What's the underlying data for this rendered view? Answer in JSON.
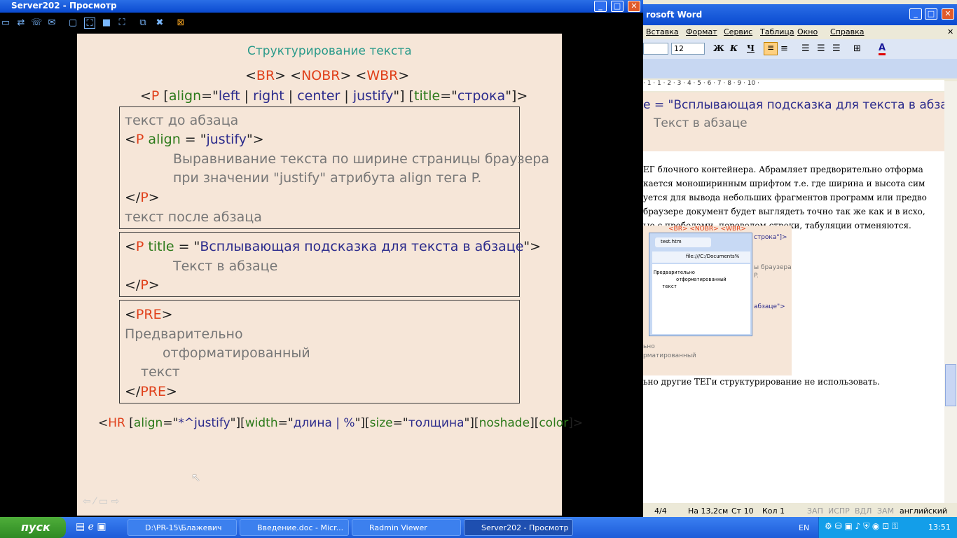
{
  "radmin": {
    "title": "Server202 - Просмотр"
  },
  "slide": {
    "heading": "Структурирование текста",
    "line1": [
      "<",
      "BR",
      "> <",
      "NOBR",
      "> <",
      "WBR",
      ">"
    ],
    "line2": [
      "<",
      "P",
      " [",
      "align",
      "=\"",
      "left",
      " | ",
      "right",
      " | ",
      "center",
      " | ",
      "justify",
      "\"] [",
      "title",
      "=\"",
      "строка",
      "\"]>"
    ],
    "box1": {
      "l1": "текст до абзаца",
      "l2": [
        "<",
        "P",
        " align",
        " = \"",
        "justify",
        "\">"
      ],
      "l3": "Выравнивание текста по ширине страницы браузера",
      "l4": "при значении \"justify\" атрибута align тега P.",
      "l5": [
        "</",
        "P",
        ">"
      ],
      "l6": "текст после абзаца"
    },
    "box2": {
      "l1": [
        "<",
        "P",
        " title",
        " = \"",
        "Всплывающая подсказка для текста в абзаце",
        "\">"
      ],
      "l2": "Текст в абзаце",
      "l3": [
        "</",
        "P",
        ">"
      ]
    },
    "box3": {
      "l1": [
        "<",
        "PRE",
        ">"
      ],
      "l2": "Предварительно",
      "l3": "отформатированный",
      "l4": "текст",
      "l5": [
        "</",
        "PRE",
        ">"
      ]
    },
    "hr": [
      "<",
      "HR",
      " [",
      "align",
      "=\"",
      "*^justify",
      "\"][",
      "width",
      "=\"",
      "длина | %",
      "\"][",
      "size",
      "=\"",
      "толщина",
      "\"][",
      "noshade",
      "][",
      "color",
      "]>"
    ]
  },
  "word": {
    "title": "rosoft Word",
    "menu": [
      "Вставка",
      "Формат",
      "Сервис",
      "Таблица",
      "Окно",
      "Справка"
    ],
    "font_size": "12",
    "fmt_buttons": [
      "Ж",
      "К",
      "Ч"
    ],
    "ruler": "· 1 · 1 · 2 · 3 · 4 · 5 · 6 · 7 · 8 · 9 · 10 ·",
    "doc_line1": "e = \"Всплывающая подсказка для текста в абзаце\">",
    "doc_line2": "Текст в абзаце",
    "para": [
      "ЕГ блочного контейнера. Абрамляет предворительно отформа",
      "кается моноширинным шрифтом т.е. где ширина и высота сим",
      "уется для вывода небольших фрагментов программ или предво",
      " браузере документ будет выглядеть точно так же как и в исхо,",
      "ые с пробелами, переводом строки, табуляции отменяются."
    ],
    "thumb": {
      "line1": "<BR> <NOBR> <WBR>",
      "right1": "строка\"]>",
      "right2": "ы браузера",
      "right3": "P.",
      "right4": "абзаце\">",
      "left1": "ьно",
      "left2": "рматированный"
    },
    "browser": {
      "tab": "test.htm",
      "url": "file:///C:/Documents%",
      "text1": "Предварительно",
      "text2": "отформатированный",
      "text3": "текст"
    },
    "para2": "ьно другие ТЕГи структурирование не использовать.",
    "status": [
      "4/4",
      "На 13,2см",
      "Ст 10",
      "Кол 1",
      "ЗАП",
      "ИСПР",
      "ВДЛ",
      "ЗАМ",
      "английский"
    ]
  },
  "taskbar": {
    "start": "пуск",
    "items": [
      "D:\\PR-15\\Блажевич",
      "Введение.doc - Micr...",
      "Radmin Viewer",
      "Server202 - Просмотр"
    ],
    "lang": "EN",
    "clock": "13:51"
  }
}
